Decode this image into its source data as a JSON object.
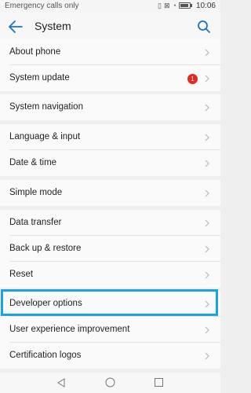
{
  "status_bar": {
    "carrier_text": "Emergency calls only",
    "icons": [
      "vibrate-icon",
      "no-sim-icon",
      "wifi-icon",
      "battery-icon"
    ],
    "time": "10:06"
  },
  "app_bar": {
    "title": "System",
    "back_icon": "arrow-back-icon",
    "search_icon": "search-icon",
    "accent": "#1a73c9"
  },
  "groups": [
    {
      "items": [
        {
          "label": "About phone"
        },
        {
          "label": "System update",
          "badge": "1"
        }
      ]
    },
    {
      "items": [
        {
          "label": "System navigation"
        }
      ]
    },
    {
      "items": [
        {
          "label": "Language & input"
        },
        {
          "label": "Date & time"
        }
      ]
    },
    {
      "items": [
        {
          "label": "Simple mode"
        }
      ]
    },
    {
      "items": [
        {
          "label": "Data transfer"
        },
        {
          "label": "Back up & restore"
        },
        {
          "label": "Reset"
        }
      ]
    },
    {
      "items": [
        {
          "label": "Developer options",
          "highlighted": true
        },
        {
          "label": "User experience improvement"
        },
        {
          "label": "Certification logos"
        }
      ]
    }
  ],
  "colors": {
    "badge": "#e42a1a",
    "highlight_border": "#1aa3df"
  }
}
